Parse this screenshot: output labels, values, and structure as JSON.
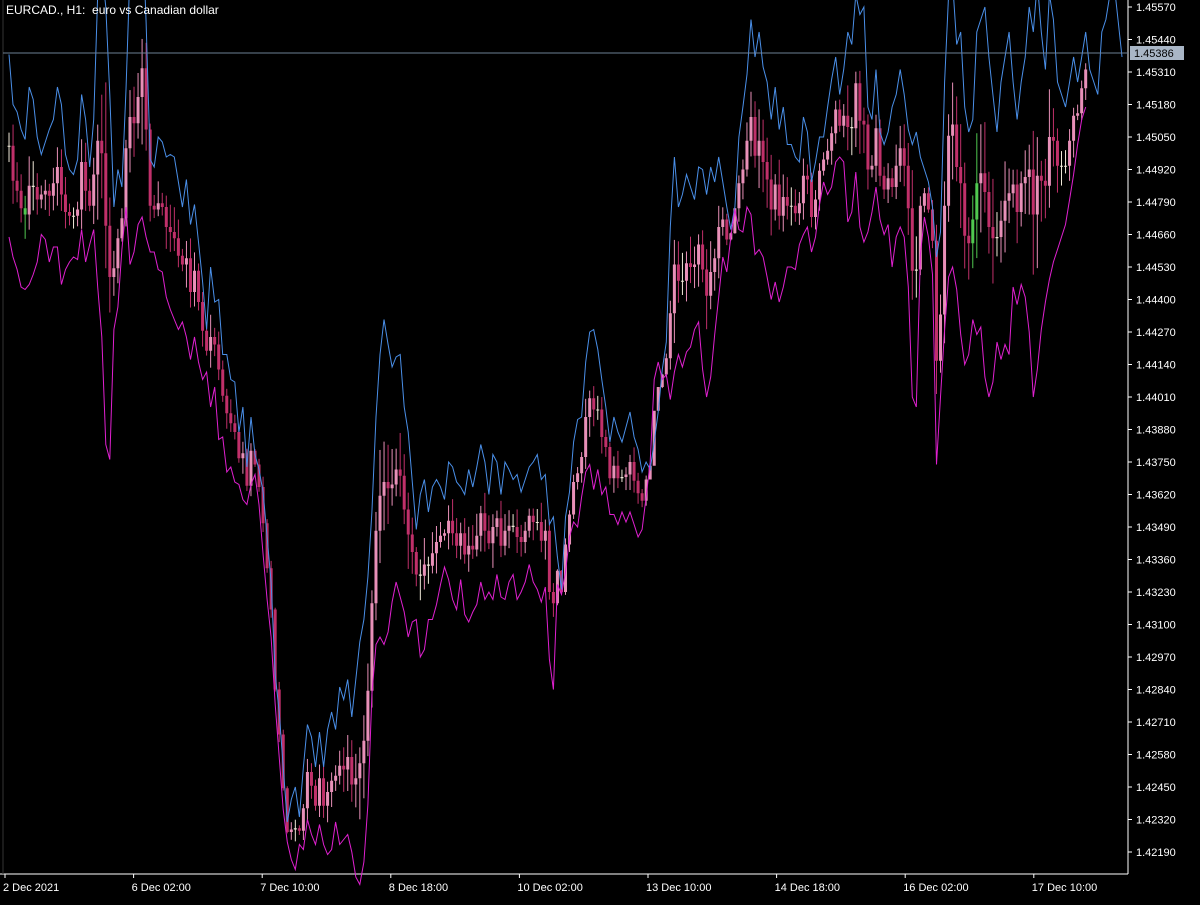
{
  "header": {
    "symbol": "EURCAD., H1:",
    "description": "euro vs Canadian dollar"
  },
  "colors": {
    "background": "#000000",
    "axis": "#ffffff",
    "text": "#ffffff",
    "upper_band": "#4a8fe8",
    "lower_band": "#e020d0",
    "candle_body": "#e890b8",
    "candle_body_dark": "#c0306a",
    "candle_doji": "#f0e8d8",
    "candle_green": "#50c850",
    "price_line": "#6d7f95",
    "price_label_bg": "#a9b6c6",
    "price_label_text": "#000000"
  },
  "chart_data": {
    "type": "candlestick-with-bands",
    "title": "EURCAD., H1:  euro vs Canadian dollar",
    "y_ticks": [
      "1.45570",
      "1.45440",
      "1.45310",
      "1.45180",
      "1.45050",
      "1.44920",
      "1.44790",
      "1.44660",
      "1.44530",
      "1.44400",
      "1.44270",
      "1.44140",
      "1.44010",
      "1.43880",
      "1.43750",
      "1.43620",
      "1.43490",
      "1.43360",
      "1.43230",
      "1.43100",
      "1.42970",
      "1.42840",
      "1.42710",
      "1.42580",
      "1.42450",
      "1.42320",
      "1.42190"
    ],
    "ylim": [
      1.4212,
      1.4558
    ],
    "x_ticks": [
      "2 Dec 2021",
      "6 Dec 02:00",
      "7 Dec 10:00",
      "8 Dec 18:00",
      "10 Dec 02:00",
      "13 Dec 10:00",
      "14 Dec 18:00",
      "16 Dec 02:00",
      "17 Dec 10:00"
    ],
    "current_price": "1.45386",
    "series": [
      {
        "name": "Upper band",
        "style": "line",
        "values": [
          1.4538,
          1.4518,
          1.4515,
          1.4508,
          1.4504,
          1.4525,
          1.452,
          1.4505,
          1.4498,
          1.4503,
          1.4508,
          1.4512,
          1.4525,
          1.4518,
          1.4498,
          1.4492,
          1.449,
          1.4496,
          1.4522,
          1.4512,
          1.4493,
          1.4512,
          1.4562,
          1.4572,
          1.4557,
          1.4522,
          1.4477,
          1.4492,
          1.4485,
          1.4524,
          1.4572,
          1.4562,
          1.4572,
          1.4592,
          1.4551,
          1.4496,
          1.4493,
          1.4505,
          1.4503,
          1.4497,
          1.4498,
          1.4497,
          1.4487,
          1.4477,
          1.4488,
          1.447,
          1.4478,
          1.4463,
          1.4447,
          1.4428,
          1.4453,
          1.4439,
          1.444,
          1.4418,
          1.4418,
          1.4408,
          1.4407,
          1.4387,
          1.4397,
          1.4373,
          1.4393,
          1.4378,
          1.4372,
          1.4363,
          1.4345,
          1.4327,
          1.429,
          1.4275,
          1.4253,
          1.4231,
          1.424,
          1.4245,
          1.4233,
          1.4253,
          1.427,
          1.4265,
          1.4253,
          1.4267,
          1.4253,
          1.4268,
          1.4275,
          1.4268,
          1.4285,
          1.428,
          1.4288,
          1.4273,
          1.4288,
          1.4303,
          1.4312,
          1.4329,
          1.4355,
          1.4393,
          1.4418,
          1.4432,
          1.4422,
          1.4413,
          1.4417,
          1.4418,
          1.4397,
          1.4387,
          1.4367,
          1.4348,
          1.4362,
          1.4368,
          1.4355,
          1.4365,
          1.4368,
          1.4365,
          1.436,
          1.4375,
          1.4373,
          1.4367,
          1.4365,
          1.4362,
          1.4372,
          1.4365,
          1.4373,
          1.4382,
          1.4375,
          1.4362,
          1.4378,
          1.4375,
          1.4362,
          1.4375,
          1.4372,
          1.4368,
          1.437,
          1.4363,
          1.4368,
          1.4373,
          1.4375,
          1.4378,
          1.4368,
          1.437,
          1.435,
          1.4353,
          1.4337,
          1.4324,
          1.4353,
          1.4363,
          1.4383,
          1.4392,
          1.4393,
          1.4415,
          1.4427,
          1.4428,
          1.442,
          1.4408,
          1.4397,
          1.4383,
          1.4393,
          1.4387,
          1.4383,
          1.4389,
          1.4395,
          1.4385,
          1.438,
          1.4371,
          1.4375,
          1.4372,
          1.4383,
          1.4395,
          1.4412,
          1.4423,
          1.4469,
          1.4497,
          1.4477,
          1.4482,
          1.449,
          1.4485,
          1.448,
          1.4493,
          1.4492,
          1.4482,
          1.4493,
          1.4487,
          1.4497,
          1.4487,
          1.4477,
          1.4468,
          1.4477,
          1.4505,
          1.4517,
          1.453,
          1.4552,
          1.4537,
          1.4547,
          1.4533,
          1.4527,
          1.4512,
          1.4525,
          1.4508,
          1.4517,
          1.4502,
          1.4502,
          1.4497,
          1.4495,
          1.4513,
          1.4507,
          1.4487,
          1.4495,
          1.4505,
          1.4505,
          1.4517,
          1.4528,
          1.4537,
          1.4522,
          1.4532,
          1.4547,
          1.4542,
          1.4562,
          1.4554,
          1.4557,
          1.4517,
          1.4512,
          1.4532,
          1.4507,
          1.4502,
          1.4507,
          1.4517,
          1.4522,
          1.4532,
          1.4522,
          1.4508,
          1.4502,
          1.4507,
          1.4497,
          1.4492,
          1.4487,
          1.4477,
          1.4457,
          1.4467,
          1.4527,
          1.4562,
          1.4567,
          1.4542,
          1.4547,
          1.4517,
          1.4507,
          1.4512,
          1.4547,
          1.4552,
          1.4557,
          1.4537,
          1.4522,
          1.4507,
          1.4527,
          1.4537,
          1.4547,
          1.4527,
          1.4512,
          1.4527,
          1.4537,
          1.4557,
          1.4547,
          1.4567,
          1.4547,
          1.4532,
          1.4562,
          1.4552,
          1.4527,
          1.4522,
          1.4517,
          1.4527,
          1.4537,
          1.4527,
          1.4537,
          1.4547,
          1.4532,
          1.4527,
          1.4522,
          1.4547,
          1.4552,
          1.4562,
          1.4567,
          1.4552,
          1.4537
        ]
      },
      {
        "name": "Lower band",
        "style": "line",
        "values": [
          1.4465,
          1.4457,
          1.4452,
          1.4445,
          1.4444,
          1.4446,
          1.445,
          1.4455,
          1.4466,
          1.4464,
          1.4455,
          1.4461,
          1.4461,
          1.4446,
          1.4452,
          1.4455,
          1.4457,
          1.4456,
          1.4468,
          1.4455,
          1.4462,
          1.4468,
          1.4445,
          1.4425,
          1.4382,
          1.4376,
          1.4428,
          1.4437,
          1.446,
          1.4477,
          1.4454,
          1.4459,
          1.447,
          1.4473,
          1.4465,
          1.4459,
          1.4459,
          1.4452,
          1.4451,
          1.4441,
          1.4436,
          1.4432,
          1.4428,
          1.4431,
          1.4425,
          1.4416,
          1.4425,
          1.4415,
          1.4408,
          1.4411,
          1.4397,
          1.4405,
          1.4384,
          1.4385,
          1.4371,
          1.4373,
          1.4367,
          1.4366,
          1.436,
          1.4358,
          1.4366,
          1.437,
          1.4358,
          1.4338,
          1.432,
          1.4305,
          1.4278,
          1.4257,
          1.4236,
          1.4223,
          1.4216,
          1.4212,
          1.4222,
          1.422,
          1.4232,
          1.4226,
          1.4222,
          1.423,
          1.4222,
          1.4218,
          1.422,
          1.4231,
          1.4222,
          1.4224,
          1.4226,
          1.4219,
          1.4209,
          1.4206,
          1.4215,
          1.4238,
          1.4282,
          1.4302,
          1.4305,
          1.4302,
          1.4307,
          1.4319,
          1.4327,
          1.4321,
          1.4315,
          1.4305,
          1.4311,
          1.4312,
          1.4297,
          1.43,
          1.4312,
          1.4312,
          1.4318,
          1.4326,
          1.4333,
          1.4328,
          1.432,
          1.4316,
          1.4328,
          1.4314,
          1.4311,
          1.4315,
          1.4318,
          1.4327,
          1.432,
          1.4323,
          1.432,
          1.433,
          1.4321,
          1.432,
          1.4327,
          1.433,
          1.432,
          1.4323,
          1.4327,
          1.4334,
          1.4327,
          1.4324,
          1.4319,
          1.4325,
          1.4296,
          1.4284,
          1.4326,
          1.4322,
          1.4331,
          1.4345,
          1.4351,
          1.4349,
          1.4361,
          1.4371,
          1.4374,
          1.4364,
          1.4372,
          1.4362,
          1.4365,
          1.4354,
          1.4354,
          1.435,
          1.4355,
          1.4351,
          1.4355,
          1.435,
          1.4345,
          1.4348,
          1.4361,
          1.4375,
          1.4408,
          1.4415,
          1.4408,
          1.441,
          1.44,
          1.4411,
          1.4418,
          1.4413,
          1.4419,
          1.4421,
          1.4428,
          1.4431,
          1.4412,
          1.4401,
          1.4409,
          1.4426,
          1.4441,
          1.4457,
          1.4451,
          1.4465,
          1.4476,
          1.4468,
          1.4467,
          1.4477,
          1.4474,
          1.4458,
          1.446,
          1.4457,
          1.4449,
          1.444,
          1.4447,
          1.4439,
          1.4445,
          1.4453,
          1.4453,
          1.4452,
          1.4462,
          1.4466,
          1.4469,
          1.4459,
          1.4465,
          1.4478,
          1.4487,
          1.4482,
          1.4485,
          1.4495,
          1.4497,
          1.4495,
          1.4471,
          1.4475,
          1.4491,
          1.4469,
          1.4463,
          1.4467,
          1.4475,
          1.4485,
          1.4472,
          1.4466,
          1.447,
          1.4453,
          1.4465,
          1.4469,
          1.4465,
          1.4445,
          1.4401,
          1.4397,
          1.4458,
          1.4473,
          1.4465,
          1.445,
          1.4374,
          1.4401,
          1.4428,
          1.4449,
          1.4453,
          1.4444,
          1.4426,
          1.4414,
          1.4418,
          1.4432,
          1.4426,
          1.4429,
          1.4409,
          1.4401,
          1.4407,
          1.4423,
          1.4416,
          1.4422,
          1.4418,
          1.4445,
          1.4438,
          1.4446,
          1.4441,
          1.4427,
          1.4401,
          1.4412,
          1.4428,
          1.4439,
          1.4448,
          1.4455,
          1.446,
          1.4465,
          1.447,
          1.448,
          1.449,
          1.4502,
          1.4512,
          1.4517
        ]
      }
    ]
  },
  "axis": {
    "price_label": "1.45386"
  }
}
